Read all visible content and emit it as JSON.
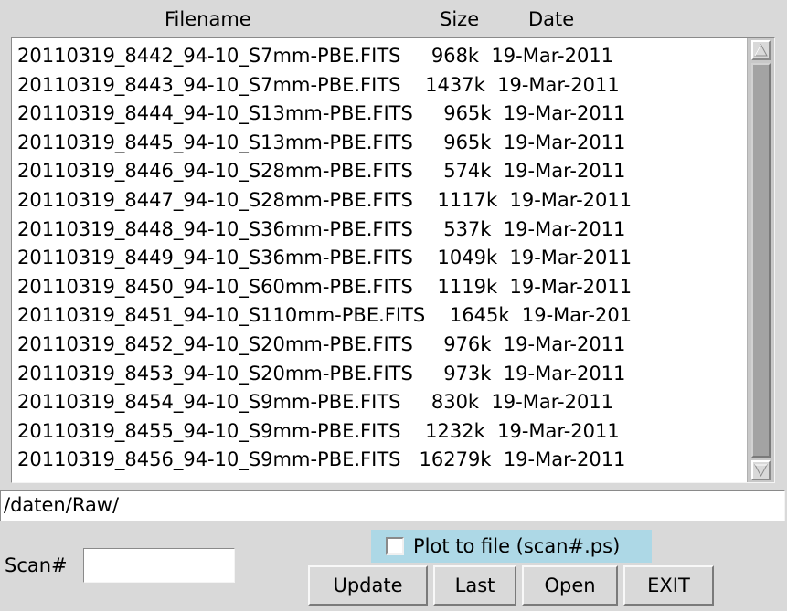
{
  "header": {
    "filename": "Filename",
    "size": "Size",
    "date": "Date"
  },
  "files": [
    "20110319_8442_94-10_S7mm-PBE.FITS     968k  19-Mar-2011",
    "20110319_8443_94-10_S7mm-PBE.FITS    1437k  19-Mar-2011",
    "20110319_8444_94-10_S13mm-PBE.FITS     965k  19-Mar-2011",
    "20110319_8445_94-10_S13mm-PBE.FITS     965k  19-Mar-2011",
    "20110319_8446_94-10_S28mm-PBE.FITS     574k  19-Mar-2011",
    "20110319_8447_94-10_S28mm-PBE.FITS    1117k  19-Mar-2011",
    "20110319_8448_94-10_S36mm-PBE.FITS     537k  19-Mar-2011",
    "20110319_8449_94-10_S36mm-PBE.FITS    1049k  19-Mar-2011",
    "20110319_8450_94-10_S60mm-PBE.FITS    1119k  19-Mar-2011",
    "20110319_8451_94-10_S110mm-PBE.FITS    1645k  19-Mar-201",
    "20110319_8452_94-10_S20mm-PBE.FITS     976k  19-Mar-2011",
    "20110319_8453_94-10_S20mm-PBE.FITS     973k  19-Mar-2011",
    "20110319_8454_94-10_S9mm-PBE.FITS     830k  19-Mar-2011",
    "20110319_8455_94-10_S9mm-PBE.FITS    1232k  19-Mar-2011",
    "20110319_8456_94-10_S9mm-PBE.FITS   16279k  19-Mar-2011"
  ],
  "path": "/daten/Raw/",
  "plot_to_file": {
    "label": "Plot to file (scan#.ps)",
    "checked": false,
    "background": "#add8e6"
  },
  "scan": {
    "label": "Scan#",
    "value": ""
  },
  "buttons": {
    "update": "Update",
    "last": "Last",
    "open": "Open",
    "exit": "EXIT"
  },
  "colors": {
    "window_bg": "#d9d9d9",
    "list_bg": "#ffffff",
    "scroll_trough": "#a3a3a3"
  },
  "icons": {
    "scroll_up": "triangle-up-icon",
    "scroll_down": "triangle-down-icon"
  }
}
